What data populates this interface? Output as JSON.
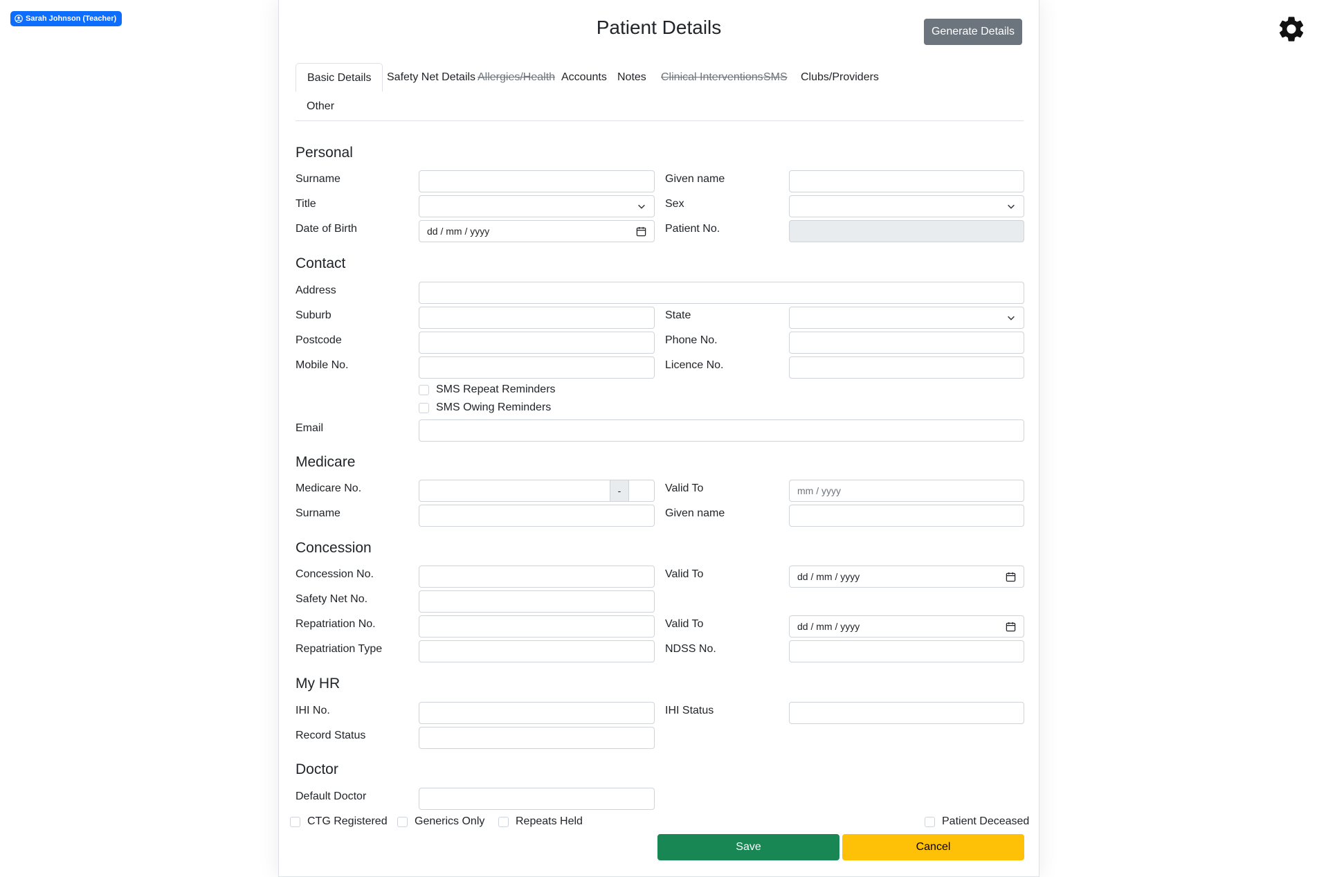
{
  "user_badge": {
    "label": "Sarah Johnson (Teacher)",
    "icon": "user-circle-icon"
  },
  "settings": {
    "icon": "gear-icon"
  },
  "modal": {
    "title": "Patient Details",
    "generate_button": "Generate Details"
  },
  "tabs": [
    {
      "label": "Basic Details",
      "active": true,
      "struck": false
    },
    {
      "label": "Safety Net Details",
      "active": false,
      "struck": false
    },
    {
      "label": "Allergies/Health",
      "active": false,
      "struck": true
    },
    {
      "label": "Accounts",
      "active": false,
      "struck": false
    },
    {
      "label": "Notes",
      "active": false,
      "struck": false
    },
    {
      "label": "Clinical Interventions",
      "active": false,
      "struck": true
    },
    {
      "label": "SMS",
      "active": false,
      "struck": true
    },
    {
      "label": "Clubs/Providers",
      "active": false,
      "struck": false
    },
    {
      "label": "Other",
      "active": false,
      "struck": false
    }
  ],
  "sections": {
    "personal": "Personal",
    "contact": "Contact",
    "medicare": "Medicare",
    "concession": "Concession",
    "myhr": "My HR",
    "doctor": "Doctor"
  },
  "labels": {
    "surname": "Surname",
    "given_name": "Given name",
    "title": "Title",
    "sex": "Sex",
    "dob": "Date of Birth",
    "patient_no": "Patient No.",
    "address": "Address",
    "suburb": "Suburb",
    "state": "State",
    "postcode": "Postcode",
    "phone_no": "Phone No.",
    "mobile_no": "Mobile No.",
    "licence_no": "Licence No.",
    "email": "Email",
    "medicare_no": "Medicare No.",
    "valid_to": "Valid To",
    "medicare_surname": "Surname",
    "medicare_given_name": "Given name",
    "concession_no": "Concession No.",
    "safety_net_no": "Safety Net No.",
    "repatriation_no": "Repatriation No.",
    "repatriation_type": "Repatriation Type",
    "ndss_no": "NDSS No.",
    "ihi_no": "IHI No.",
    "ihi_status": "IHI Status",
    "record_status": "Record Status",
    "default_doctor": "Default Doctor"
  },
  "placeholders": {
    "date": "dd / mm / yyyy",
    "month_year": "mm / yyyy",
    "medicare_sep": "-"
  },
  "checkboxes": {
    "sms_repeat": "SMS Repeat Reminders",
    "sms_owing": "SMS Owing Reminders",
    "ctg_registered": "CTG Registered",
    "generics_only": "Generics Only",
    "repeats_held": "Repeats Held",
    "patient_deceased": "Patient Deceased"
  },
  "buttons": {
    "save": "Save",
    "cancel": "Cancel"
  },
  "colors": {
    "primary": "#0d6efd",
    "secondary": "#6c757d",
    "success": "#198754",
    "warning": "#ffc107"
  }
}
